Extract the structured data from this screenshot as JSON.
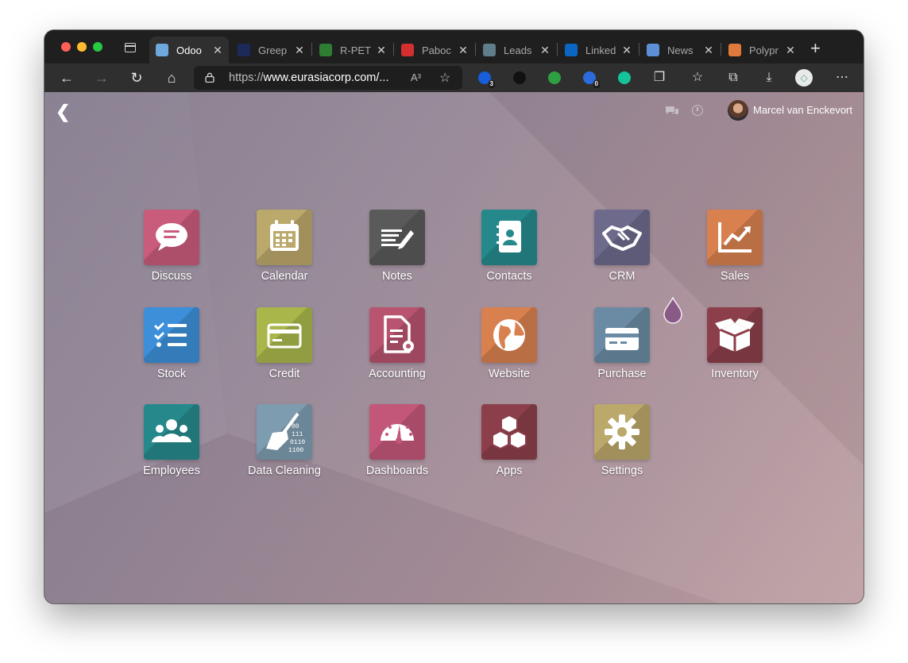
{
  "browser": {
    "tabs": [
      {
        "title": "Odoo",
        "favicon": "odoo-icon",
        "color": "#6fa8dc",
        "active": true
      },
      {
        "title": "Greep",
        "favicon": "greep-icon",
        "color": "#1c2a5a",
        "active": false
      },
      {
        "title": "R-PET",
        "favicon": "r-pet-icon",
        "color": "#2e7d32",
        "active": false
      },
      {
        "title": "Paboc",
        "favicon": "paboco-icon",
        "color": "#d32f2f",
        "active": false
      },
      {
        "title": "Leads",
        "favicon": "leads-icon",
        "color": "#607d8b",
        "active": false
      },
      {
        "title": "Linked",
        "favicon": "linkedin-icon",
        "color": "#0a66c2",
        "active": false
      },
      {
        "title": "News",
        "favicon": "news-icon",
        "color": "#5c8fd6",
        "active": false
      },
      {
        "title": "Polypr",
        "favicon": "polypr-icon",
        "color": "#e07a3c",
        "active": false
      }
    ],
    "url_prefix": "https://",
    "url_host": "www.eurasiacorp.com/...",
    "read_aloud": "A³",
    "extensions": [
      {
        "name": "bitwarden-icon",
        "color": "#175ddc",
        "badge": "3"
      },
      {
        "name": "privacy-icon",
        "color": "#111111",
        "badge": ""
      },
      {
        "name": "checkmark-icon",
        "color": "#2ea043",
        "badge": ""
      },
      {
        "name": "bot-icon",
        "color": "#2d6bdd",
        "badge": "0"
      },
      {
        "name": "grammarly-icon",
        "color": "#15c39a",
        "badge": ""
      }
    ]
  },
  "odoo": {
    "user_name": "Marcel van Enckevort",
    "apps": [
      {
        "label": "Discuss",
        "icon": "chat-bubble-icon",
        "color": "#c95b7b"
      },
      {
        "label": "Calendar",
        "icon": "calendar-icon",
        "color": "#bba86b"
      },
      {
        "label": "Notes",
        "icon": "notes-icon",
        "color": "#5a5a5a"
      },
      {
        "label": "Contacts",
        "icon": "address-book-icon",
        "color": "#25898c"
      },
      {
        "label": "CRM",
        "icon": "handshake-icon",
        "color": "#6e6a8c"
      },
      {
        "label": "Sales",
        "icon": "chart-line-icon",
        "color": "#d9804f"
      },
      {
        "label": "Stock",
        "icon": "checklist-icon",
        "color": "#3d8fd9"
      },
      {
        "label": "Credit",
        "icon": "credit-card-icon",
        "color": "#a9b74a"
      },
      {
        "label": "Accounting",
        "icon": "invoice-gear-icon",
        "color": "#b85470"
      },
      {
        "label": "Website",
        "icon": "globe-icon",
        "color": "#d9804f"
      },
      {
        "label": "Purchase",
        "icon": "purchase-card-icon",
        "color": "#6a8ba3"
      },
      {
        "label": "Inventory",
        "icon": "box-icon",
        "color": "#8c3f4a"
      },
      {
        "label": "Employees",
        "icon": "people-icon",
        "color": "#25898c"
      },
      {
        "label": "Data Cleaning",
        "icon": "broom-icon",
        "color": "#7d9cb0"
      },
      {
        "label": "Dashboards",
        "icon": "speedometer-icon",
        "color": "#c2577a"
      },
      {
        "label": "Apps",
        "icon": "cubes-icon",
        "color": "#8c3f4a"
      },
      {
        "label": "Settings",
        "icon": "gear-icon",
        "color": "#bba86b"
      }
    ]
  }
}
